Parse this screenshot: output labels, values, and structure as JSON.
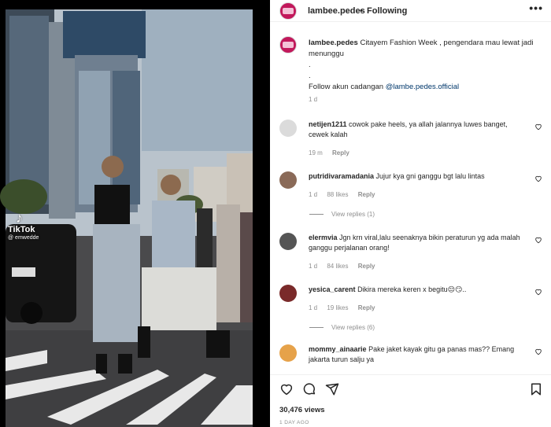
{
  "video": {
    "watermark_brand": "TikTok",
    "watermark_handle": "@ emwedde"
  },
  "post": {
    "author": "lambee.pedes",
    "separator": "•",
    "follow_status": "Following",
    "more_label": "•••",
    "caption": {
      "username": "lambee.pedes",
      "text": "Citayem Fashion Week , pengendara mau lewat jadi menunggu",
      "dot1": ".",
      "dot2": ".",
      "follow_text": "Follow akun cadangan ",
      "mention": "@lambe.pedes.official",
      "time": "1 d"
    },
    "comments": [
      {
        "username": "netijen1211",
        "text": "cowok pake heels, ya allah jalannya luwes banget, cewek kalah",
        "time": "19 m",
        "likes": "",
        "reply": "Reply",
        "view_replies": ""
      },
      {
        "username": "putridivaramadania",
        "text": "Jujur kya gni ganggu bgt lalu lintas",
        "time": "1 d",
        "likes": "88 likes",
        "reply": "Reply",
        "view_replies": "View replies (1)"
      },
      {
        "username": "elermvia",
        "text": "Jgn krn viral,lalu seenaknya bikin peraturun yg ada malah ganggu perjalanan orang!",
        "time": "1 d",
        "likes": "84 likes",
        "reply": "Reply",
        "view_replies": ""
      },
      {
        "username": "yesica_carent",
        "text": "Dikira mereka keren x begitu😔😏..",
        "time": "1 d",
        "likes": "19 likes",
        "reply": "Reply",
        "view_replies": "View replies (6)"
      },
      {
        "username": "mommy_ainaarie",
        "text": "Pake jaket kayak gitu ga panas mas?? Emang jakarta turun salju ya",
        "time": "",
        "likes": "",
        "reply": "",
        "view_replies": ""
      }
    ],
    "views": "30,476 views",
    "posted": "1 DAY AGO"
  },
  "icons": [
    "heart-icon",
    "comment-icon",
    "share-icon",
    "bookmark-icon",
    "more-icon",
    "tiktok-icon"
  ]
}
